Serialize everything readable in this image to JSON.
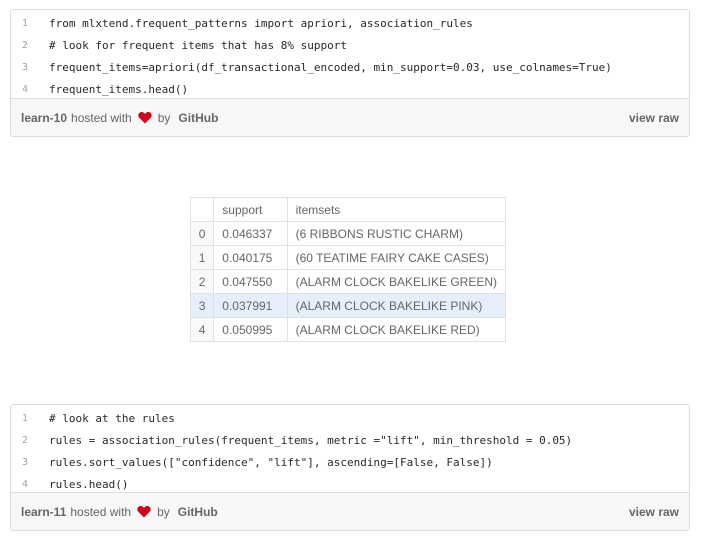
{
  "gist1": {
    "lines": [
      {
        "n": "1",
        "code": "from mlxtend.frequent_patterns import apriori, association_rules"
      },
      {
        "n": "2",
        "code": "# look for frequent items that has 8% support"
      },
      {
        "n": "3",
        "code": "frequent_items=apriori(df_transactional_encoded, min_support=0.03, use_colnames=True)"
      },
      {
        "n": "4",
        "code": "frequent_items.head()"
      }
    ],
    "name": "learn-10",
    "hosted_with": "hosted with",
    "by": "by",
    "github": "GitHub",
    "view_raw": "view raw"
  },
  "table": {
    "headers": [
      "",
      "support",
      "itemsets"
    ],
    "rows": [
      {
        "idx": "0",
        "support": "0.046337",
        "itemsets": "(6 RIBBONS RUSTIC CHARM)"
      },
      {
        "idx": "1",
        "support": "0.040175",
        "itemsets": "(60 TEATIME FAIRY CAKE CASES)"
      },
      {
        "idx": "2",
        "support": "0.047550",
        "itemsets": "(ALARM CLOCK BAKELIKE GREEN)"
      },
      {
        "idx": "3",
        "support": "0.037991",
        "itemsets": "(ALARM CLOCK BAKELIKE PINK)"
      },
      {
        "idx": "4",
        "support": "0.050995",
        "itemsets": "(ALARM CLOCK BAKELIKE RED)"
      }
    ],
    "highlight_row": 3,
    "highlight_color": "#e6eefb"
  },
  "gist2": {
    "lines": [
      {
        "n": "1",
        "code": "# look at the rules"
      },
      {
        "n": "2",
        "code": "rules = association_rules(frequent_items, metric =\"lift\", min_threshold = 0.05)"
      },
      {
        "n": "3",
        "code": "rules.sort_values([\"confidence\", \"lift\"], ascending=[False, False])"
      },
      {
        "n": "4",
        "code": "rules.head()"
      }
    ],
    "name": "learn-11",
    "hosted_with": "hosted with",
    "by": "by",
    "github": "GitHub",
    "view_raw": "view raw"
  },
  "icons": {
    "heart": "heart-icon",
    "heart_color": "#d0021b"
  }
}
